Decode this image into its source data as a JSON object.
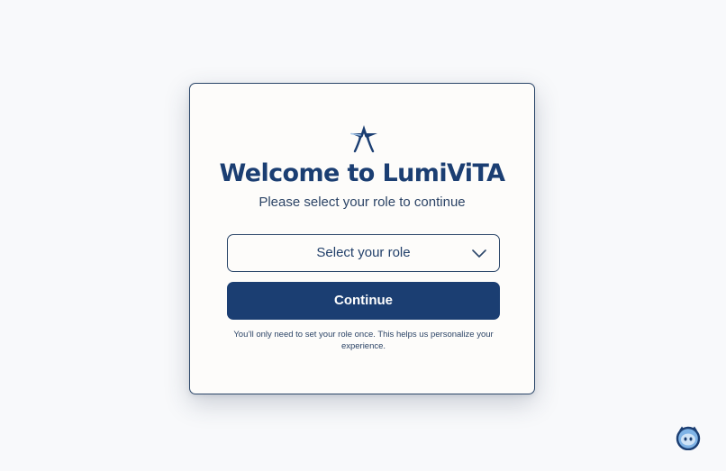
{
  "app": {
    "title": "Welcome to LumiViTA",
    "subtitle": "Please select your role to continue",
    "logo_icon": "lumivita-star-icon"
  },
  "role_select": {
    "selected_label": "Select your role",
    "icon": "chevron-down-icon"
  },
  "actions": {
    "continue_label": "Continue"
  },
  "note": {
    "text": "You’ll only need to set your role once. This helps us personalize your experience."
  },
  "assistant": {
    "icon": "assistant-avatar-icon"
  },
  "colors": {
    "brand_navy": "#1b3e72",
    "border": "#2b4669",
    "card_bg": "#fdfcfa",
    "page_bg": "#f8f9fb",
    "assistant_blue": "#7fb3e6"
  }
}
